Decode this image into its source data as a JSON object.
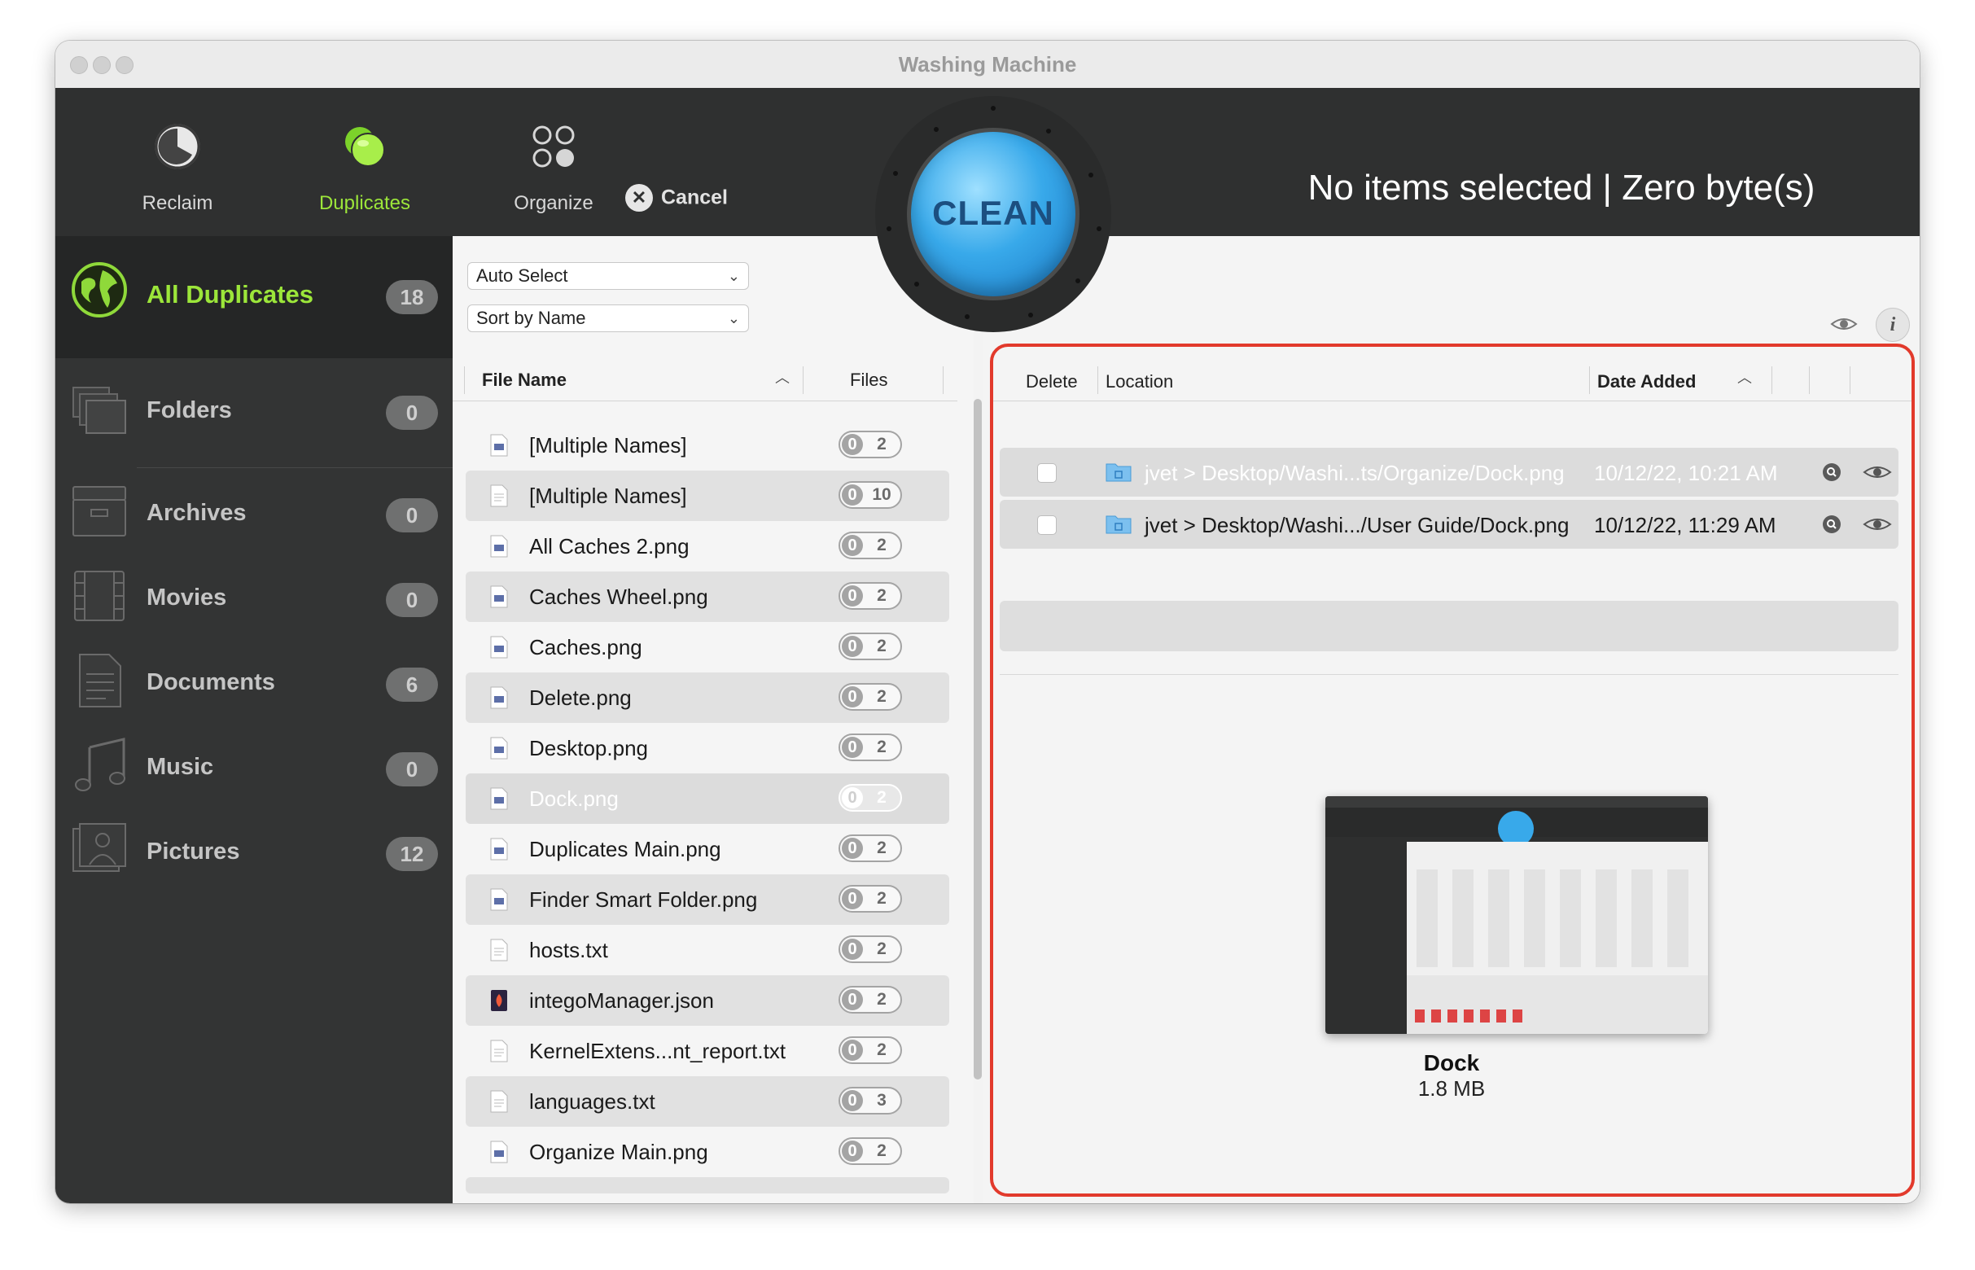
{
  "window": {
    "title": "Washing Machine"
  },
  "toolbar": {
    "tools": [
      {
        "label": "Reclaim",
        "icon": "reclaim-icon"
      },
      {
        "label": "Duplicates",
        "icon": "duplicates-icon",
        "active": true
      },
      {
        "label": "Organize",
        "icon": "organize-icon"
      }
    ],
    "cancel_label": "Cancel",
    "clean_label": "CLEAN",
    "status": "No items selected | Zero byte(s)"
  },
  "sidebar": {
    "items": [
      {
        "label": "All Duplicates",
        "count": "18",
        "icon": "globe-icon",
        "selected": true
      },
      {
        "label": "Folders",
        "count": "0",
        "icon": "folders-icon"
      },
      {
        "label": "Archives",
        "count": "0",
        "icon": "archives-icon"
      },
      {
        "label": "Movies",
        "count": "0",
        "icon": "movies-icon"
      },
      {
        "label": "Documents",
        "count": "6",
        "icon": "documents-icon"
      },
      {
        "label": "Music",
        "count": "0",
        "icon": "music-icon"
      },
      {
        "label": "Pictures",
        "count": "12",
        "icon": "pictures-icon"
      }
    ]
  },
  "filelist": {
    "auto_select": "Auto Select",
    "sort_by": "Sort by Name",
    "col_name": "File Name",
    "col_files": "Files",
    "rows": [
      {
        "name": "[Multiple Names]",
        "sel": "0",
        "total": "2"
      },
      {
        "name": "[Multiple Names]",
        "sel": "0",
        "total": "10"
      },
      {
        "name": "All Caches 2.png",
        "sel": "0",
        "total": "2"
      },
      {
        "name": "Caches Wheel.png",
        "sel": "0",
        "total": "2"
      },
      {
        "name": "Caches.png",
        "sel": "0",
        "total": "2"
      },
      {
        "name": "Delete.png",
        "sel": "0",
        "total": "2"
      },
      {
        "name": "Desktop.png",
        "sel": "0",
        "total": "2"
      },
      {
        "name": "Dock.png",
        "sel": "0",
        "total": "2",
        "selected": true
      },
      {
        "name": "Duplicates Main.png",
        "sel": "0",
        "total": "2"
      },
      {
        "name": "Finder Smart Folder.png",
        "sel": "0",
        "total": "2"
      },
      {
        "name": "hosts.txt",
        "sel": "0",
        "total": "2"
      },
      {
        "name": "integoManager.json",
        "sel": "0",
        "total": "2"
      },
      {
        "name": "KernelExtens...nt_report.txt",
        "sel": "0",
        "total": "2"
      },
      {
        "name": "languages.txt",
        "sel": "0",
        "total": "3"
      },
      {
        "name": "Organize Main.png",
        "sel": "0",
        "total": "2"
      }
    ]
  },
  "detail": {
    "col_delete": "Delete",
    "col_location": "Location",
    "col_date": "Date Added",
    "rows": [
      {
        "path": "jvet > Desktop/Washi...ts/Organize/Dock.png",
        "date": "10/12/22, 10:21 AM",
        "selected": true
      },
      {
        "path": "jvet > Desktop/Washi.../User Guide/Dock.png",
        "date": "10/12/22, 11:29 AM"
      }
    ],
    "preview_name": "Dock",
    "preview_size": "1.8 MB"
  },
  "colors": {
    "accent_green": "#9ce63a",
    "highlight": "#e23a2c",
    "clean_blue": "#38a9ea"
  }
}
